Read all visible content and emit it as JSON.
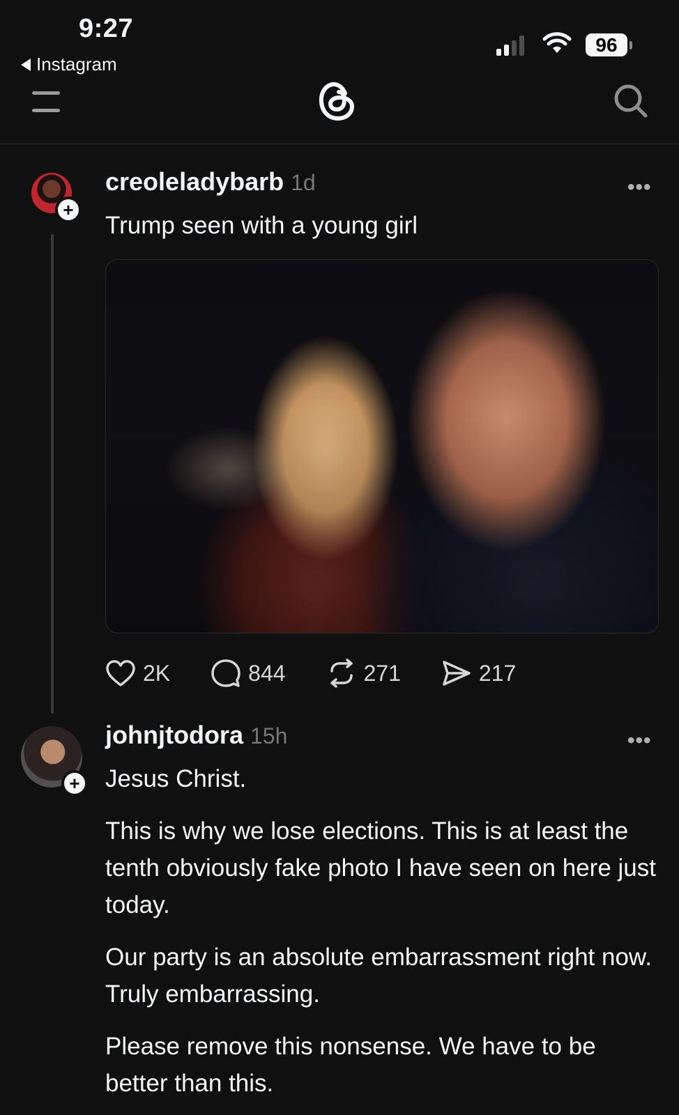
{
  "status_bar": {
    "time": "9:27",
    "back_app": "Instagram",
    "battery": "96"
  },
  "nav": {
    "menu_icon": "menu-icon",
    "logo_icon": "threads-logo-icon",
    "search_icon": "search-icon"
  },
  "post": {
    "username": "creoleladybarb",
    "time": "1d",
    "text": "Trump seen with a young girl",
    "more": "•••",
    "actions": {
      "likes": "2K",
      "comments": "844",
      "reposts": "271",
      "shares": "217"
    }
  },
  "reply": {
    "username": "johnjtodora",
    "time": "15h",
    "more": "•••",
    "paragraphs": [
      "Jesus Christ.",
      "This is why we lose elections. This is at least the tenth obviously fake photo I have seen on here just today.",
      "Our party is an absolute embarrassment right now. Truly embarrassing.",
      "Please remove this nonsense. We have to be better than this."
    ]
  }
}
